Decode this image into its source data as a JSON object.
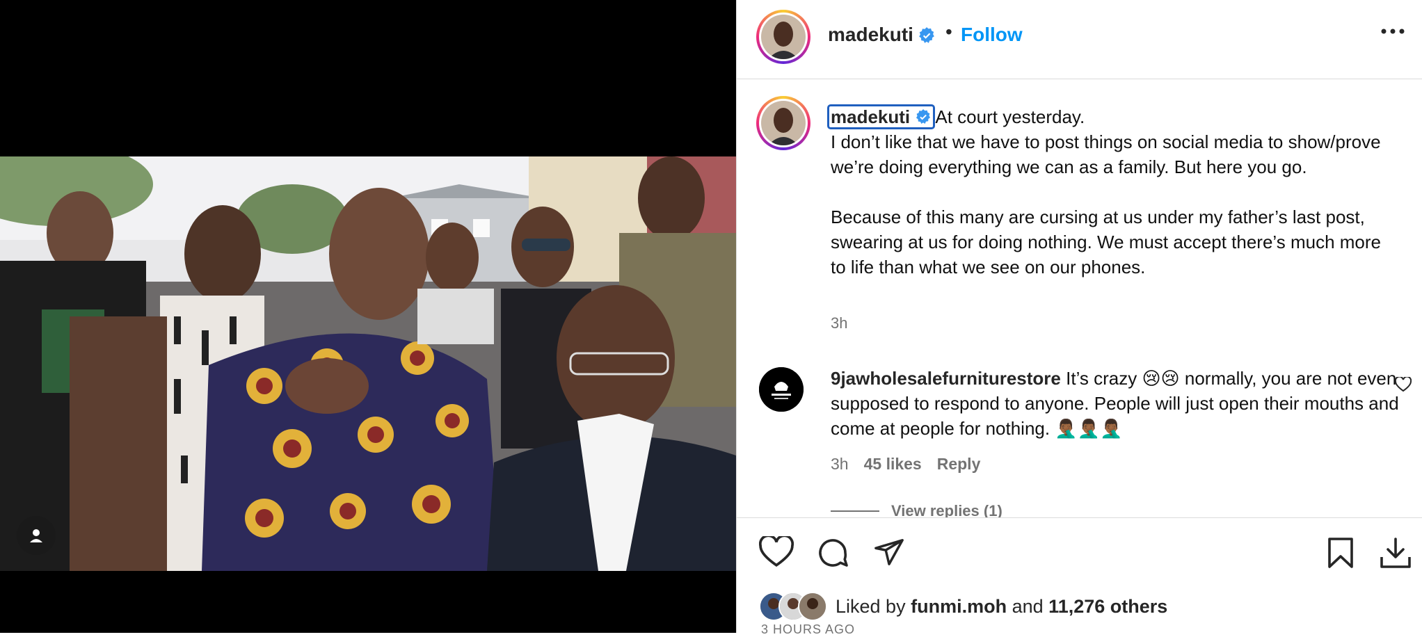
{
  "post": {
    "username": "madekuti",
    "follow_label": "Follow",
    "separator": "•",
    "caption_lines": [
      "At court yesterday.",
      "I don’t like that we have to post things on social media to show/prove we’re doing everything we can as a family. But here you go.",
      "Because of this many are cursing at us under my father’s last post, swearing at us for doing nothing. We must accept there’s much more to life than what we see on our phones."
    ],
    "caption_time": "3h"
  },
  "comment": {
    "username": "9jawholesalefurniturestore",
    "text": "It’s crazy 😢😢 normally, you are not even supposed to respond to anyone. People will just open their mouths and come at people for nothing. 🤦🏾‍♂️🤦🏾‍♂️🤦🏾‍♂️",
    "time": "3h",
    "likes": "45 likes",
    "reply_label": "Reply",
    "view_replies": "View replies (1)"
  },
  "likes": {
    "prefix": "Liked by",
    "user": "funmi.moh",
    "joiner": "and",
    "others": "11,276 others"
  },
  "date": "3 HOURS AGO",
  "colors": {
    "accent": "#0095f6",
    "verified": "#3897f0",
    "muted": "#737373"
  },
  "icons": [
    "verified-badge-icon",
    "more-options-icon",
    "heart-icon",
    "comment-icon",
    "share-icon",
    "bookmark-icon",
    "download-icon",
    "person-tag-icon"
  ]
}
